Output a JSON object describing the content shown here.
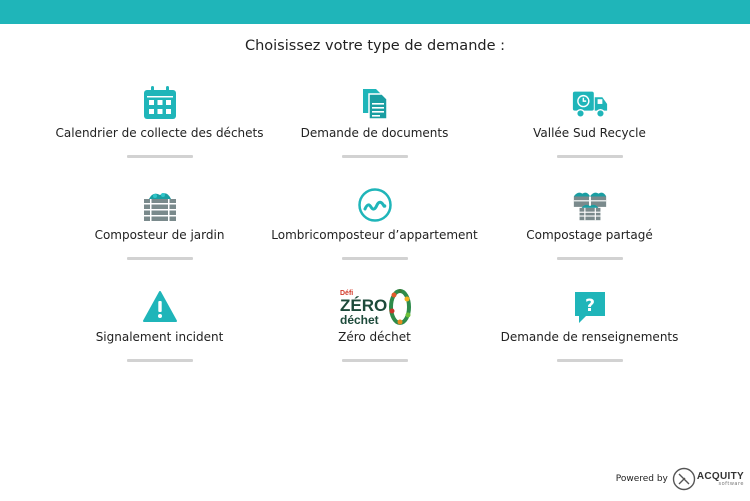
{
  "page": {
    "title": "Choisissez votre type de demande :"
  },
  "theme": {
    "accent": "#1fb5b9",
    "icon_gray": "#7a8a8c",
    "bar": "#d2d2d2"
  },
  "cards": [
    {
      "label": "Calendrier de collecte des déchets",
      "icon": "calendar-icon"
    },
    {
      "label": "Demande de documents",
      "icon": "documents-icon"
    },
    {
      "label": "Vallée Sud Recycle",
      "icon": "truck-icon"
    },
    {
      "label": "Composteur de jardin",
      "icon": "garden-composter-icon"
    },
    {
      "label": "Lombricomposteur d’appartement",
      "icon": "worm-composter-icon"
    },
    {
      "label": "Compostage partagé",
      "icon": "shared-composting-icon"
    },
    {
      "label": "Signalement incident",
      "icon": "warning-icon"
    },
    {
      "label": "Zéro déchet",
      "icon": "zero-dechet-logo"
    },
    {
      "label": "Demande de renseignements",
      "icon": "question-bubble-icon"
    }
  ],
  "zero_logo": {
    "defi": "Défi",
    "zero": "ZÉRO",
    "dechet": "déchet"
  },
  "footer": {
    "powered_by": "Powered by",
    "brand": "ACQUITY",
    "brand_sub": "software"
  }
}
